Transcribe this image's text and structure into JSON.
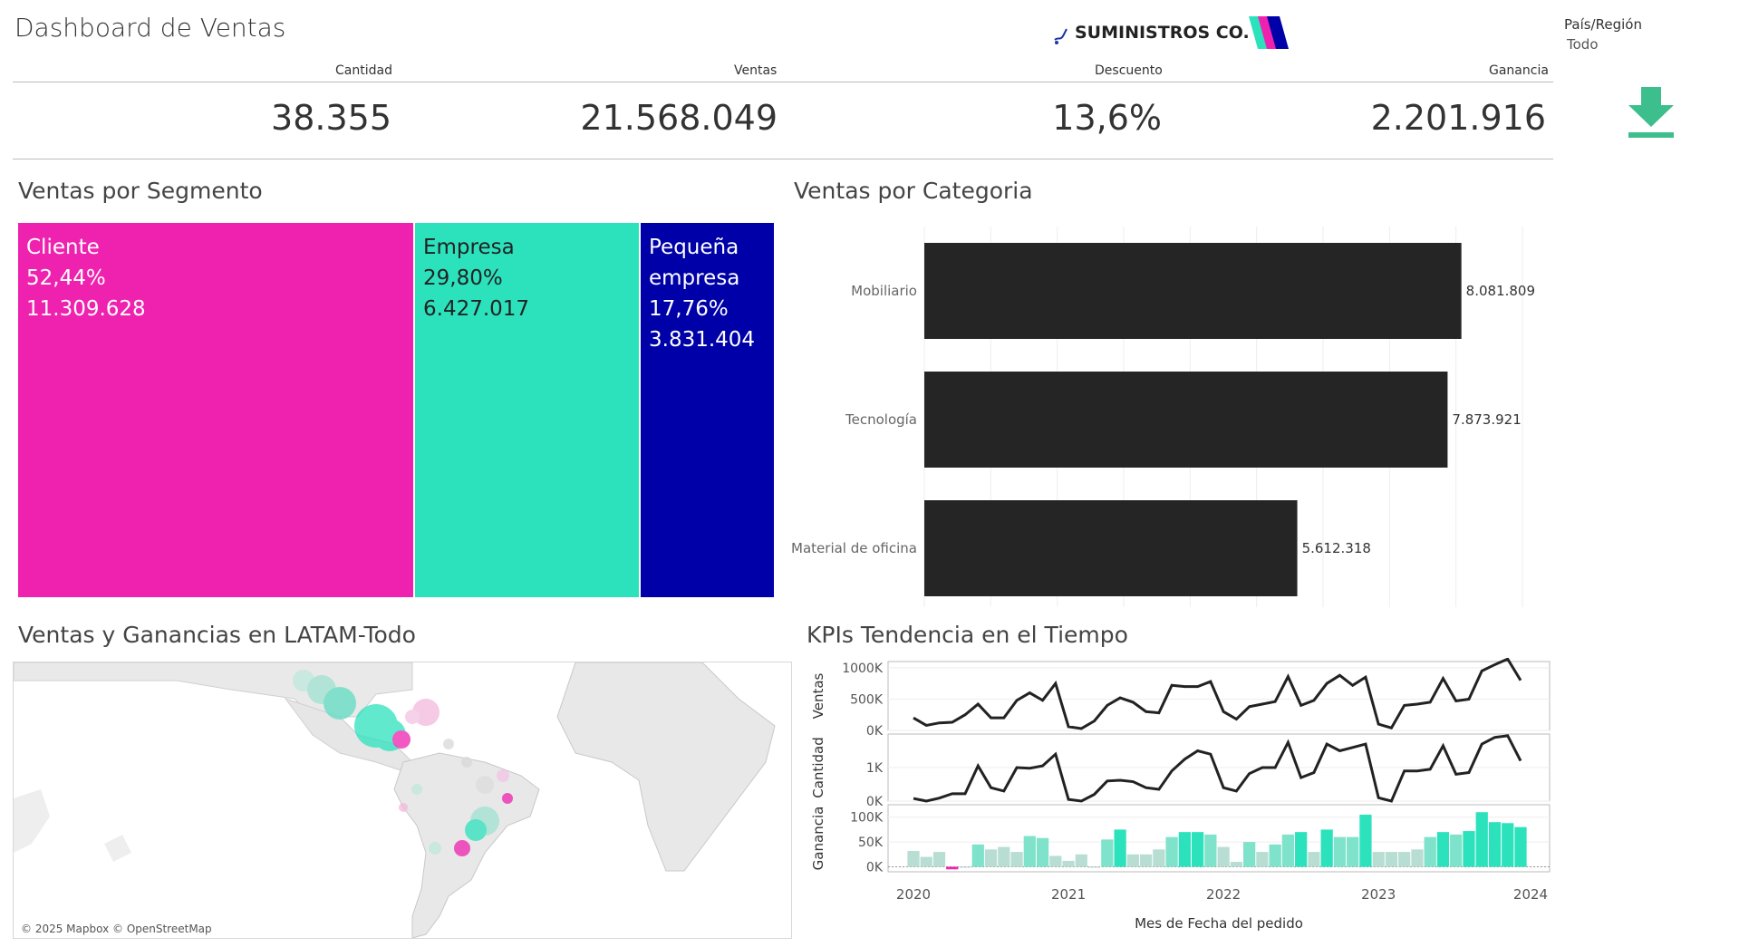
{
  "page": {
    "title": "Dashboard de Ventas",
    "logo_text": "SUMINISTROS CO.",
    "filter": {
      "label": "País/Región",
      "value": "Todo"
    },
    "download_icon": "download-icon",
    "colors": {
      "pink": "#EE22AE",
      "teal": "#2CE2BD",
      "navy": "#0000A8",
      "bar": "#252525",
      "download": "#3DBE8D"
    }
  },
  "kpis": [
    {
      "label": "Cantidad",
      "value": "38.355"
    },
    {
      "label": "Ventas",
      "value": "21.568.049"
    },
    {
      "label": "Descuento",
      "value": "13,6%"
    },
    {
      "label": "Ganancia",
      "value": "2.201.916"
    }
  ],
  "segment": {
    "title": "Ventas por Segmento",
    "cells": [
      {
        "name": "Cliente",
        "pct": "52,44%",
        "value": "11.309.628",
        "color": "#EE22AE"
      },
      {
        "name": "Empresa",
        "pct": "29,80%",
        "value": "6.427.017",
        "color": "#2CE2BD"
      },
      {
        "name": "Pequeña empresa",
        "pct": "17,76%",
        "value": "3.831.404",
        "color": "#0000A8"
      }
    ]
  },
  "category": {
    "title": "Ventas por Categoria",
    "chart_data": {
      "type": "bar",
      "orientation": "horizontal",
      "categories": [
        "Mobiliario",
        "Tecnología",
        "Material de oficina"
      ],
      "values": [
        8081809,
        7873921,
        5612318
      ],
      "labels": [
        "8.081.809",
        "7.873.921",
        "5.612.318"
      ],
      "xlim": [
        0,
        9000000
      ],
      "grid": true
    }
  },
  "map": {
    "title": "Ventas y Ganancias en LATAM-Todo",
    "attribution": "© 2025 Mapbox © OpenStreetMap"
  },
  "trend": {
    "title": "KPIs Tendencia en el Tiempo",
    "xlabel": "Mes de Fecha del pedido",
    "year_ticks": [
      "2020",
      "2021",
      "2022",
      "2023",
      "2024"
    ],
    "chart_data": {
      "type": "line",
      "x": [
        "2020-01",
        "2020-02",
        "2020-03",
        "2020-04",
        "2020-05",
        "2020-06",
        "2020-07",
        "2020-08",
        "2020-09",
        "2020-10",
        "2020-11",
        "2020-12",
        "2021-01",
        "2021-02",
        "2021-03",
        "2021-04",
        "2021-05",
        "2021-06",
        "2021-07",
        "2021-08",
        "2021-09",
        "2021-10",
        "2021-11",
        "2021-12",
        "2022-01",
        "2022-02",
        "2022-03",
        "2022-04",
        "2022-05",
        "2022-06",
        "2022-07",
        "2022-08",
        "2022-09",
        "2022-10",
        "2022-11",
        "2022-12",
        "2023-01",
        "2023-02",
        "2023-03",
        "2023-04",
        "2023-05",
        "2023-06",
        "2023-07",
        "2023-08",
        "2023-09",
        "2023-10",
        "2023-11",
        "2023-12"
      ],
      "series": [
        {
          "name": "Ventas",
          "ticks": [
            "1000K",
            "500K",
            "0K"
          ],
          "ylim": [
            0,
            1100000
          ],
          "values": [
            200000,
            80000,
            120000,
            130000,
            250000,
            420000,
            200000,
            200000,
            480000,
            600000,
            480000,
            750000,
            60000,
            30000,
            150000,
            400000,
            520000,
            450000,
            300000,
            280000,
            720000,
            700000,
            700000,
            780000,
            300000,
            180000,
            380000,
            420000,
            460000,
            860000,
            400000,
            480000,
            750000,
            880000,
            720000,
            850000,
            100000,
            40000,
            400000,
            420000,
            450000,
            830000,
            470000,
            500000,
            950000,
            1050000,
            1140000,
            800000
          ]
        },
        {
          "name": "Cantidad",
          "ticks": [
            "1K",
            "0K"
          ],
          "ylim": [
            0,
            2000
          ],
          "values": [
            80,
            0,
            90,
            220,
            220,
            1050,
            400,
            300,
            1000,
            980,
            1050,
            1400,
            50,
            0,
            200,
            600,
            620,
            580,
            400,
            350,
            900,
            1250,
            1500,
            1400,
            400,
            300,
            820,
            1000,
            1000,
            1750,
            700,
            850,
            1700,
            1500,
            1600,
            1700,
            100,
            0,
            900,
            900,
            950,
            1650,
            800,
            850,
            1700,
            1900,
            1950,
            1200
          ]
        },
        {
          "name": "Ganancia",
          "type": "bar",
          "ticks": [
            "100K",
            "50K",
            "0K"
          ],
          "ylim": [
            -10000,
            125000
          ],
          "values": [
            32000,
            20000,
            30000,
            -5000,
            0,
            45000,
            35000,
            40000,
            30000,
            62000,
            58000,
            22000,
            12000,
            25000,
            0,
            55000,
            75000,
            25000,
            25000,
            35000,
            60000,
            70000,
            70000,
            65000,
            40000,
            10000,
            50000,
            30000,
            45000,
            65000,
            70000,
            30000,
            75000,
            60000,
            60000,
            105000,
            30000,
            30000,
            30000,
            35000,
            60000,
            70000,
            65000,
            72000,
            110000,
            90000,
            88000,
            80000
          ]
        }
      ]
    }
  }
}
